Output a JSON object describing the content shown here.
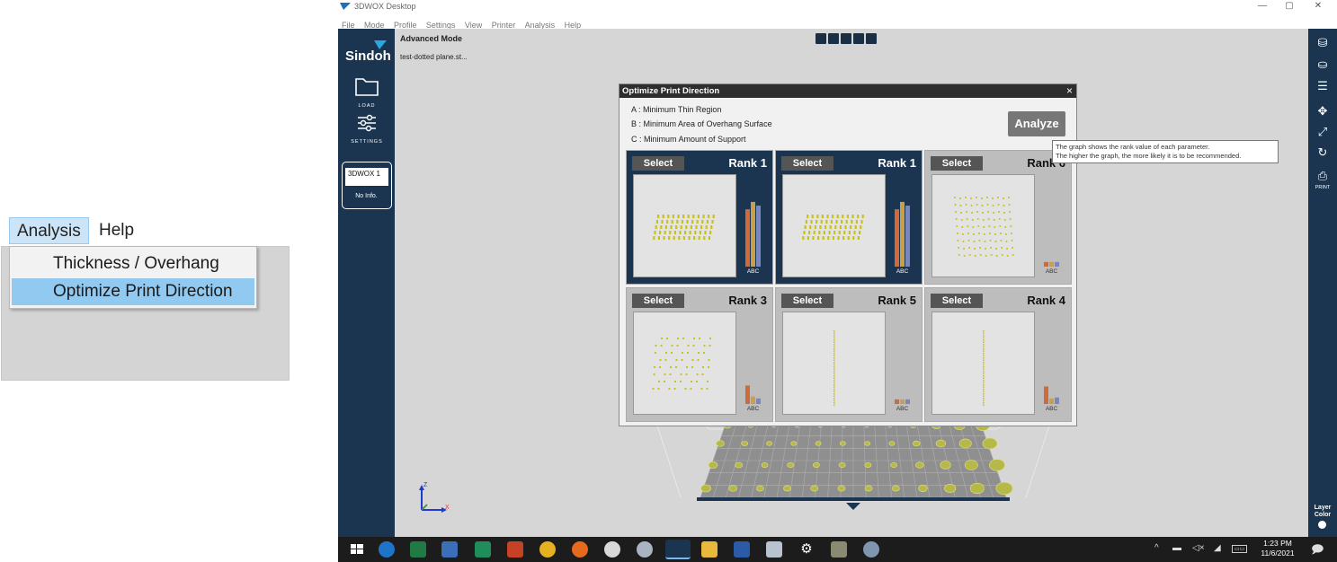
{
  "inset": {
    "menu": [
      "Analysis",
      "Help"
    ],
    "dropdown": [
      "Thickness / Overhang",
      "Optimize Print Direction"
    ]
  },
  "window": {
    "title": "3DWOX Desktop",
    "menu": [
      "File",
      "Mode",
      "Profile",
      "Settings",
      "View",
      "Printer",
      "Analysis",
      "Help"
    ],
    "controls": [
      "—",
      "▢",
      "✕"
    ]
  },
  "sidebar": {
    "brand": "Sindoh",
    "load_label": "LOAD",
    "settings_label": "SETTINGS",
    "printer_name": "3DWOX 1",
    "printer_info": "No Info."
  },
  "viewport": {
    "mode": "Advanced Mode",
    "file": "test-dotted plane.st...",
    "axis_x": "X",
    "axis_z": "Z"
  },
  "rightbar": {
    "print_label": "PRINT",
    "layer_color_label_1": "Layer",
    "layer_color_label_2": "Color"
  },
  "dialog": {
    "title": "Optimize Print Direction",
    "close": "×",
    "legend": [
      "A : Minimum Thin Region",
      "B : Minimum Area of Overhang Surface",
      "C : Minimum Amount of Support"
    ],
    "analyze_label": "Analyze",
    "select_label": "Select",
    "abc_label": "ABC",
    "cards": [
      {
        "rank": "Rank 1",
        "selected": true,
        "bars": [
          0.62,
          0.7,
          0.66
        ]
      },
      {
        "rank": "Rank 1",
        "selected": true,
        "bars": [
          0.62,
          0.7,
          0.66
        ]
      },
      {
        "rank": "Rank 6",
        "selected": false,
        "bars": [
          0.05,
          0.05,
          0.05
        ]
      },
      {
        "rank": "Rank 3",
        "selected": false,
        "bars": [
          0.2,
          0.08,
          0.06
        ]
      },
      {
        "rank": "Rank 5",
        "selected": false,
        "bars": [
          0.05,
          0.05,
          0.05
        ]
      },
      {
        "rank": "Rank 4",
        "selected": false,
        "bars": [
          0.19,
          0.06,
          0.07
        ]
      }
    ],
    "tooltip_lines": [
      "The graph shows the rank value of each parameter.",
      "The higher the graph, the more likely it is to be recommended."
    ]
  },
  "colors": {
    "sidebar": "#1b3550",
    "bar_a": "#d06a3b",
    "bar_b": "#c9a04a",
    "bar_c": "#7a86c2"
  },
  "taskbar": {
    "time": "1:23 PM",
    "date": "11/6/2021"
  }
}
